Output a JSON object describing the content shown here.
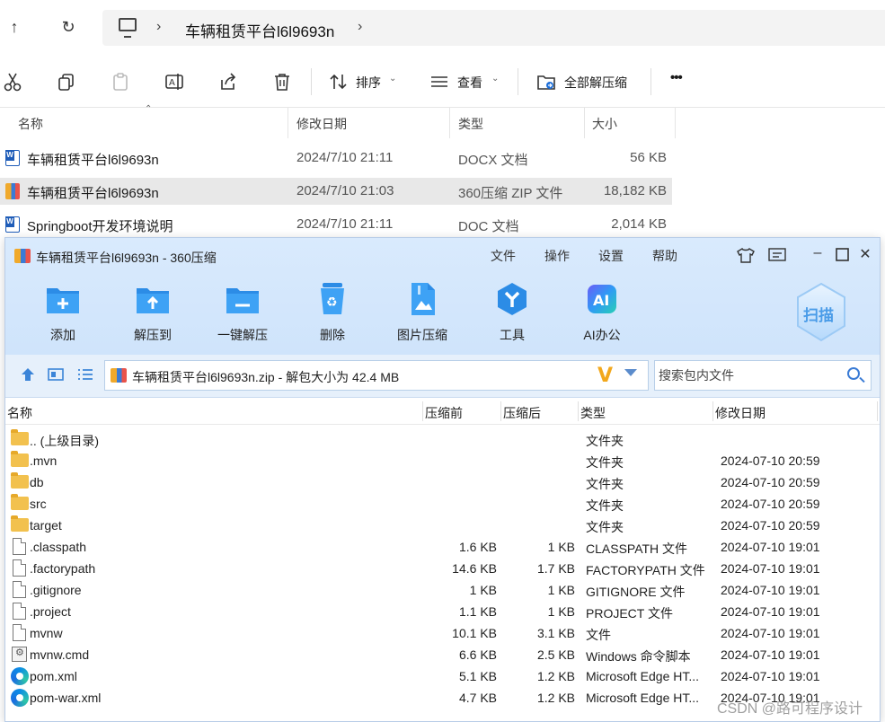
{
  "explorer": {
    "breadcrumb": "车辆租赁平台l6l9693n",
    "toolbar": {
      "sort_label": "排序",
      "view_label": "查看",
      "extract_all_label": "全部解压缩",
      "more_label": "•••"
    },
    "columns": {
      "name": "名称",
      "date": "修改日期",
      "type": "类型",
      "size": "大小"
    },
    "files": [
      {
        "name": "车辆租赁平台l6l9693n",
        "date": "2024/7/10 21:11",
        "type": "DOCX 文档",
        "size": "56 KB",
        "icon": "word-doc-icon"
      },
      {
        "name": "车辆租赁平台l6l9693n",
        "date": "2024/7/10 21:03",
        "type": "360压缩 ZIP 文件",
        "size": "18,182 KB",
        "icon": "zip-archive-icon"
      },
      {
        "name": "Springboot开发环境说明",
        "date": "2024/7/10 21:11",
        "type": "DOC 文档",
        "size": "2,014 KB",
        "icon": "word-doc-icon"
      }
    ]
  },
  "zip_window": {
    "title": "车辆租赁平台l6l9693n - 360压缩",
    "menus": [
      "文件",
      "操作",
      "设置",
      "帮助"
    ],
    "tools": [
      {
        "label": "添加",
        "icon": "add-icon"
      },
      {
        "label": "解压到",
        "icon": "extract-to-icon"
      },
      {
        "label": "一键解压",
        "icon": "one-click-extract-icon"
      },
      {
        "label": "删除",
        "icon": "delete-icon"
      },
      {
        "label": "图片压缩",
        "icon": "image-compress-icon"
      },
      {
        "label": "工具",
        "icon": "tools-icon"
      },
      {
        "label": "AI办公",
        "icon": "ai-office-icon"
      }
    ],
    "scan_label": "扫描",
    "path": "车辆租赁平台l6l9693n.zip - 解包大小为 42.4 MB",
    "search_placeholder": "搜索包内文件",
    "columns": {
      "name": "名称",
      "before": "压缩前",
      "after": "压缩后",
      "type": "类型",
      "date": "修改日期"
    },
    "rows": [
      {
        "name": ".. (上级目录)",
        "before": "",
        "after": "",
        "type": "文件夹",
        "date": "",
        "icon": "folder"
      },
      {
        "name": ".mvn",
        "before": "",
        "after": "",
        "type": "文件夹",
        "date": "2024-07-10 20:59",
        "icon": "folder"
      },
      {
        "name": "db",
        "before": "",
        "after": "",
        "type": "文件夹",
        "date": "2024-07-10 20:59",
        "icon": "folder"
      },
      {
        "name": "src",
        "before": "",
        "after": "",
        "type": "文件夹",
        "date": "2024-07-10 20:59",
        "icon": "folder"
      },
      {
        "name": "target",
        "before": "",
        "after": "",
        "type": "文件夹",
        "date": "2024-07-10 20:59",
        "icon": "folder"
      },
      {
        "name": ".classpath",
        "before": "1.6 KB",
        "after": "1 KB",
        "type": "CLASSPATH 文件",
        "date": "2024-07-10 19:01",
        "icon": "file"
      },
      {
        "name": ".factorypath",
        "before": "14.6 KB",
        "after": "1.7 KB",
        "type": "FACTORYPATH 文件",
        "date": "2024-07-10 19:01",
        "icon": "file"
      },
      {
        "name": ".gitignore",
        "before": "1 KB",
        "after": "1 KB",
        "type": "GITIGNORE 文件",
        "date": "2024-07-10 19:01",
        "icon": "file"
      },
      {
        "name": ".project",
        "before": "1.1 KB",
        "after": "1 KB",
        "type": "PROJECT 文件",
        "date": "2024-07-10 19:01",
        "icon": "file"
      },
      {
        "name": "mvnw",
        "before": "10.1 KB",
        "after": "3.1 KB",
        "type": "文件",
        "date": "2024-07-10 19:01",
        "icon": "file"
      },
      {
        "name": "mvnw.cmd",
        "before": "6.6 KB",
        "after": "2.5 KB",
        "type": "Windows 命令脚本",
        "date": "2024-07-10 19:01",
        "icon": "cmd"
      },
      {
        "name": "pom.xml",
        "before": "5.1 KB",
        "after": "1.2 KB",
        "type": "Microsoft Edge HT...",
        "date": "2024-07-10 19:01",
        "icon": "edge"
      },
      {
        "name": "pom-war.xml",
        "before": "4.7 KB",
        "after": "1.2 KB",
        "type": "Microsoft Edge HT...",
        "date": "2024-07-10 19:01",
        "icon": "edge"
      }
    ]
  },
  "watermark": "CSDN @路可程序设计"
}
